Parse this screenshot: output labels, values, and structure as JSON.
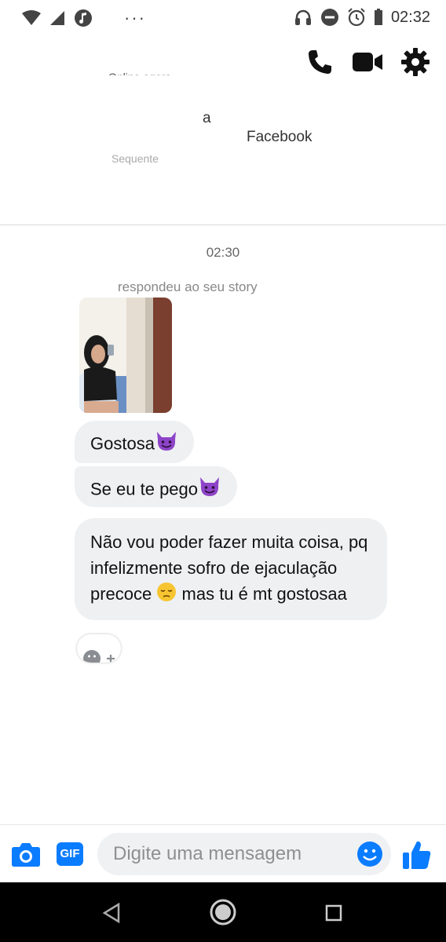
{
  "status_bar": {
    "dots": "···",
    "time": "02:32"
  },
  "header": {
    "name_fragment": "",
    "status": "Online agora"
  },
  "profile": {
    "name_fragment": "a",
    "facebook_text": "Facebook",
    "sub_text": "Sequente"
  },
  "chat": {
    "timestamp": "02:30",
    "story_reply": "respondeu ao seu story",
    "messages": [
      {
        "text": "Gostosa"
      },
      {
        "text": "Se eu te pego"
      },
      {
        "text_before_emoji": "Não vou poder fazer muita coisa, pq infelizmente sofro de ejaculação precoce",
        "text_after_emoji": " mas tu é mt gostosaa"
      }
    ]
  },
  "composer": {
    "gif_label": "GIF",
    "placeholder": "Digite uma mensagem"
  },
  "colors": {
    "accent": "#0a7cff",
    "bubble": "#eef0f2",
    "devil": "#8e44c8"
  }
}
